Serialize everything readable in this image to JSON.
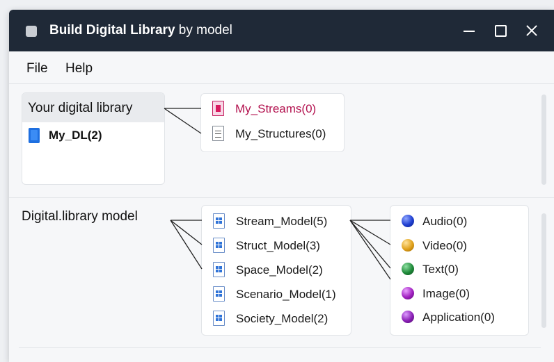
{
  "window": {
    "title_bold": "Build Digital Library",
    "title_rest": " by model"
  },
  "menu": {
    "file": "File",
    "help": "Help"
  },
  "library_panel": {
    "header": "Your digital library",
    "items": [
      {
        "label": "My_DL(2)",
        "icon": "book-icon"
      }
    ]
  },
  "library_tree": [
    {
      "label": "My_Streams(0)",
      "icon": "stream-doc-icon",
      "color": "#b3124f"
    },
    {
      "label": "My_Structures(0)",
      "icon": "document-icon"
    }
  ],
  "model_section": {
    "label": "Digital.library model",
    "models": [
      {
        "label": "Stream_Model(5)",
        "icon": "model-doc-icon"
      },
      {
        "label": "Struct_Model(3)",
        "icon": "model-doc-icon"
      },
      {
        "label": "Space_Model(2)",
        "icon": "model-doc-icon"
      },
      {
        "label": "Scenario_Model(1)",
        "icon": "model-doc-icon"
      },
      {
        "label": "Society_Model(2)",
        "icon": "model-doc-icon"
      }
    ],
    "media": [
      {
        "label": "Audio(0)",
        "icon": "blue-sphere-icon",
        "color": "#1f3fd1"
      },
      {
        "label": "Video(0)",
        "icon": "orange-sphere-icon",
        "color": "#e0a11b"
      },
      {
        "label": "Text(0)",
        "icon": "green-sphere-icon",
        "color": "#1f8a3a"
      },
      {
        "label": "Image(0)",
        "icon": "purple-sphere-icon",
        "color": "#a020c0"
      },
      {
        "label": "Application(0)",
        "icon": "purple-sphere-icon",
        "color": "#8a1fb5"
      }
    ]
  }
}
